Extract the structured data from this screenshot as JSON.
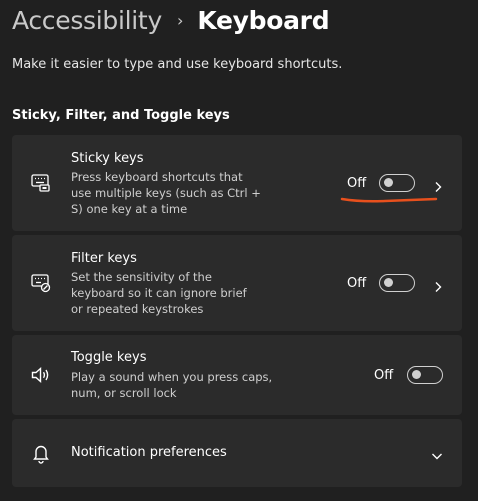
{
  "header": {
    "parent": "Accessibility",
    "separator": "›",
    "current": "Keyboard"
  },
  "subtitle": "Make it easier to type and use keyboard shortcuts.",
  "section_title": "Sticky, Filter, and Toggle keys",
  "items": [
    {
      "title": "Sticky keys",
      "desc": [
        "Press keyboard shortcuts that",
        "use multiple keys (such as Ctrl +",
        "S) one key at a time"
      ],
      "state": "Off",
      "on": false,
      "icon": "sticky-keys-keyboard-icon"
    },
    {
      "title": "Filter keys",
      "desc": [
        "Set the sensitivity of the",
        "keyboard so it can ignore brief",
        "or repeated keystrokes"
      ],
      "state": "Off",
      "on": false,
      "icon": "filter-keys-keyboard-icon"
    },
    {
      "title": "Toggle keys",
      "desc": [
        "Play a sound when you press caps,",
        "num, or scroll lock"
      ],
      "state": "Off",
      "on": false,
      "icon": "speaker-icon"
    },
    {
      "title": "Notification preferences",
      "icon": "bell-icon"
    }
  ],
  "colors": {
    "background": "#202020",
    "card": "#2b2b2b",
    "annotation": "#e8501d"
  }
}
